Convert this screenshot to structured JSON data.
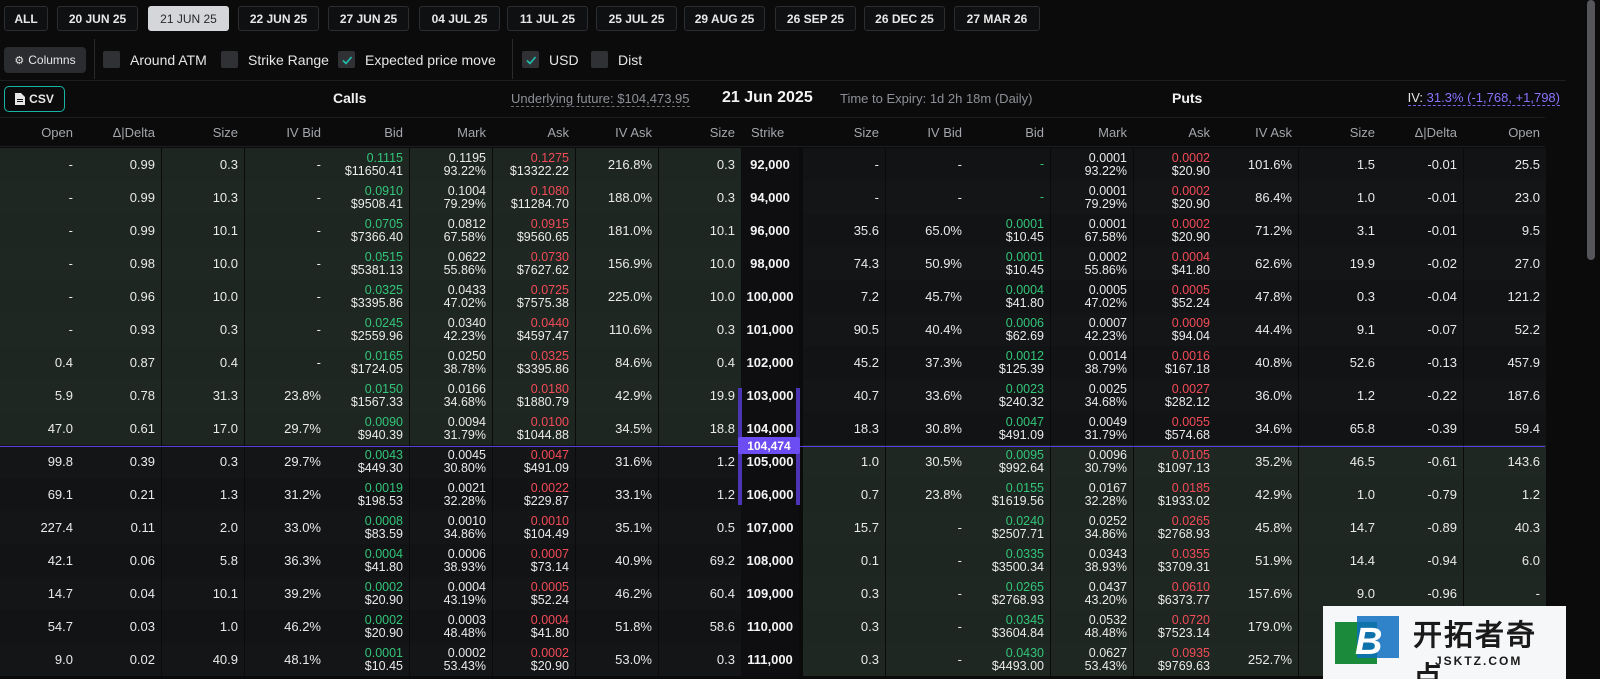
{
  "expiries": [
    "ALL",
    "20 JUN 25",
    "21 JUN 25",
    "22 JUN 25",
    "27 JUN 25",
    "04 JUL 25",
    "11 JUL 25",
    "25 JUL 25",
    "29 AUG 25",
    "26 SEP 25",
    "26 DEC 25",
    "27 MAR 26"
  ],
  "active_expiry": "21 JUN 25",
  "filters": {
    "columns_label": "Columns",
    "around_atm": {
      "label": "Around ATM",
      "checked": false
    },
    "strike_range": {
      "label": "Strike Range",
      "checked": false
    },
    "expected_move": {
      "label": "Expected price move",
      "checked": true
    },
    "usd": {
      "label": "USD",
      "checked": true
    },
    "dist": {
      "label": "Dist",
      "checked": false
    }
  },
  "header": {
    "csv_label": "CSV",
    "calls_label": "Calls",
    "puts_label": "Puts",
    "underlying": "Underlying future: $104,473.95",
    "date": "21 Jun 2025",
    "time_to_expiry": "Time to Expiry: 1d 2h 18m (Daily)",
    "iv_prefix": "IV: ",
    "iv_value": "31.3% (-1,768, +1,798)"
  },
  "columns": {
    "calls": [
      "Open",
      "Δ|Delta",
      "Size",
      "IV Bid",
      "Bid",
      "Mark",
      "Ask",
      "IV Ask",
      "Size"
    ],
    "strike": "Strike",
    "puts": [
      "Size",
      "IV Bid",
      "Bid",
      "Mark",
      "Ask",
      "IV Ask",
      "Size",
      "Δ|Delta",
      "Open"
    ]
  },
  "underlying_tag": "104,474",
  "colors": {
    "bid": "#33c57a",
    "ask": "#f34b58",
    "accent": "#6c4cf3",
    "csv_border": "#16b5a6"
  },
  "rows": [
    {
      "strike": "92,000",
      "c": [
        "-",
        "0.99",
        "0.3",
        "-",
        [
          "0.1115",
          "$11650.41"
        ],
        [
          "0.1195",
          "93.22%"
        ],
        [
          "0.1275",
          "$13322.22"
        ],
        "216.8%",
        "0.3"
      ],
      "p": [
        "-",
        "-",
        [
          "-",
          ""
        ],
        [
          "0.0001",
          "93.22%"
        ],
        [
          "0.0002",
          "$20.90"
        ],
        "101.6%",
        "1.5",
        "-0.01",
        "25.5"
      ],
      "itm": "call"
    },
    {
      "strike": "94,000",
      "c": [
        "-",
        "0.99",
        "10.3",
        "-",
        [
          "0.0910",
          "$9508.41"
        ],
        [
          "0.1004",
          "79.29%"
        ],
        [
          "0.1080",
          "$11284.70"
        ],
        "188.0%",
        "0.3"
      ],
      "p": [
        "-",
        "-",
        [
          "-",
          ""
        ],
        [
          "0.0001",
          "79.29%"
        ],
        [
          "0.0002",
          "$20.90"
        ],
        "86.4%",
        "1.0",
        "-0.01",
        "23.0"
      ],
      "itm": "call"
    },
    {
      "strike": "96,000",
      "c": [
        "-",
        "0.99",
        "10.1",
        "-",
        [
          "0.0705",
          "$7366.40"
        ],
        [
          "0.0812",
          "67.58%"
        ],
        [
          "0.0915",
          "$9560.65"
        ],
        "181.0%",
        "10.1"
      ],
      "p": [
        "35.6",
        "65.0%",
        [
          "0.0001",
          "$10.45"
        ],
        [
          "0.0001",
          "67.58%"
        ],
        [
          "0.0002",
          "$20.90"
        ],
        "71.2%",
        "3.1",
        "-0.01",
        "9.5"
      ],
      "itm": "call"
    },
    {
      "strike": "98,000",
      "c": [
        "-",
        "0.98",
        "10.0",
        "-",
        [
          "0.0515",
          "$5381.13"
        ],
        [
          "0.0622",
          "55.86%"
        ],
        [
          "0.0730",
          "$7627.62"
        ],
        "156.9%",
        "10.0"
      ],
      "p": [
        "74.3",
        "50.9%",
        [
          "0.0001",
          "$10.45"
        ],
        [
          "0.0002",
          "55.86%"
        ],
        [
          "0.0004",
          "$41.80"
        ],
        "62.6%",
        "19.9",
        "-0.02",
        "27.0"
      ],
      "itm": "call"
    },
    {
      "strike": "100,000",
      "c": [
        "-",
        "0.96",
        "10.0",
        "-",
        [
          "0.0325",
          "$3395.86"
        ],
        [
          "0.0433",
          "47.02%"
        ],
        [
          "0.0725",
          "$7575.38"
        ],
        "225.0%",
        "10.0"
      ],
      "p": [
        "7.2",
        "45.7%",
        [
          "0.0004",
          "$41.80"
        ],
        [
          "0.0005",
          "47.02%"
        ],
        [
          "0.0005",
          "$52.24"
        ],
        "47.8%",
        "0.3",
        "-0.04",
        "121.2"
      ],
      "itm": "call"
    },
    {
      "strike": "101,000",
      "c": [
        "-",
        "0.93",
        "0.3",
        "-",
        [
          "0.0245",
          "$2559.96"
        ],
        [
          "0.0340",
          "42.23%"
        ],
        [
          "0.0440",
          "$4597.47"
        ],
        "110.6%",
        "0.3"
      ],
      "p": [
        "90.5",
        "40.4%",
        [
          "0.0006",
          "$62.69"
        ],
        [
          "0.0007",
          "42.23%"
        ],
        [
          "0.0009",
          "$94.04"
        ],
        "44.4%",
        "9.1",
        "-0.07",
        "52.2"
      ],
      "itm": "call"
    },
    {
      "strike": "102,000",
      "c": [
        "0.4",
        "0.87",
        "0.4",
        "-",
        [
          "0.0165",
          "$1724.05"
        ],
        [
          "0.0250",
          "38.78%"
        ],
        [
          "0.0325",
          "$3395.86"
        ],
        "84.6%",
        "0.4"
      ],
      "p": [
        "45.2",
        "37.3%",
        [
          "0.0012",
          "$125.39"
        ],
        [
          "0.0014",
          "38.79%"
        ],
        [
          "0.0016",
          "$167.18"
        ],
        "40.8%",
        "52.6",
        "-0.13",
        "457.9"
      ],
      "itm": "call"
    },
    {
      "strike": "103,000",
      "c": [
        "5.9",
        "0.78",
        "31.3",
        "23.8%",
        [
          "0.0150",
          "$1567.33"
        ],
        [
          "0.0166",
          "34.68%"
        ],
        [
          "0.0180",
          "$1880.79"
        ],
        "42.9%",
        "19.9"
      ],
      "p": [
        "40.7",
        "33.6%",
        [
          "0.0023",
          "$240.32"
        ],
        [
          "0.0025",
          "34.68%"
        ],
        [
          "0.0027",
          "$282.12"
        ],
        "36.0%",
        "1.2",
        "-0.22",
        "187.6"
      ],
      "itm": "call"
    },
    {
      "strike": "104,000",
      "c": [
        "47.0",
        "0.61",
        "17.0",
        "29.7%",
        [
          "0.0090",
          "$940.39"
        ],
        [
          "0.0094",
          "31.79%"
        ],
        [
          "0.0100",
          "$1044.88"
        ],
        "34.5%",
        "18.8"
      ],
      "p": [
        "18.3",
        "30.8%",
        [
          "0.0047",
          "$491.09"
        ],
        [
          "0.0049",
          "31.79%"
        ],
        [
          "0.0055",
          "$574.68"
        ],
        "34.6%",
        "65.8",
        "-0.39",
        "59.4"
      ],
      "itm": "call"
    },
    {
      "strike": "105,000",
      "c": [
        "99.8",
        "0.39",
        "0.3",
        "29.7%",
        [
          "0.0043",
          "$449.30"
        ],
        [
          "0.0045",
          "30.80%"
        ],
        [
          "0.0047",
          "$491.09"
        ],
        "31.6%",
        "1.2"
      ],
      "p": [
        "1.0",
        "30.5%",
        [
          "0.0095",
          "$992.64"
        ],
        [
          "0.0096",
          "30.79%"
        ],
        [
          "0.0105",
          "$1097.13"
        ],
        "35.2%",
        "46.5",
        "-0.61",
        "143.6"
      ],
      "itm": "put"
    },
    {
      "strike": "106,000",
      "c": [
        "69.1",
        "0.21",
        "1.3",
        "31.2%",
        [
          "0.0019",
          "$198.53"
        ],
        [
          "0.0021",
          "32.28%"
        ],
        [
          "0.0022",
          "$229.87"
        ],
        "33.1%",
        "1.2"
      ],
      "p": [
        "0.7",
        "23.8%",
        [
          "0.0155",
          "$1619.56"
        ],
        [
          "0.0167",
          "32.28%"
        ],
        [
          "0.0185",
          "$1933.02"
        ],
        "42.9%",
        "1.0",
        "-0.79",
        "1.2"
      ],
      "itm": "put"
    },
    {
      "strike": "107,000",
      "c": [
        "227.4",
        "0.11",
        "2.0",
        "33.0%",
        [
          "0.0008",
          "$83.59"
        ],
        [
          "0.0010",
          "34.86%"
        ],
        [
          "0.0010",
          "$104.49"
        ],
        "35.1%",
        "0.5"
      ],
      "p": [
        "15.7",
        "-",
        [
          "0.0240",
          "$2507.71"
        ],
        [
          "0.0252",
          "34.86%"
        ],
        [
          "0.0265",
          "$2768.93"
        ],
        "45.8%",
        "14.7",
        "-0.89",
        "40.3"
      ],
      "itm": "put"
    },
    {
      "strike": "108,000",
      "c": [
        "42.1",
        "0.06",
        "5.8",
        "36.3%",
        [
          "0.0004",
          "$41.80"
        ],
        [
          "0.0006",
          "38.93%"
        ],
        [
          "0.0007",
          "$73.14"
        ],
        "40.9%",
        "69.2"
      ],
      "p": [
        "0.1",
        "-",
        [
          "0.0335",
          "$3500.34"
        ],
        [
          "0.0343",
          "38.93%"
        ],
        [
          "0.0355",
          "$3709.31"
        ],
        "51.9%",
        "14.4",
        "-0.94",
        "6.0"
      ],
      "itm": "put"
    },
    {
      "strike": "109,000",
      "c": [
        "14.7",
        "0.04",
        "10.1",
        "39.2%",
        [
          "0.0002",
          "$20.90"
        ],
        [
          "0.0004",
          "43.19%"
        ],
        [
          "0.0005",
          "$52.24"
        ],
        "46.2%",
        "60.4"
      ],
      "p": [
        "0.3",
        "-",
        [
          "0.0265",
          "$2768.93"
        ],
        [
          "0.0437",
          "43.20%"
        ],
        [
          "0.0610",
          "$6373.77"
        ],
        "157.6%",
        "9.0",
        "-0.96",
        "-"
      ],
      "itm": "put"
    },
    {
      "strike": "110,000",
      "c": [
        "54.7",
        "0.03",
        "1.0",
        "46.2%",
        [
          "0.0002",
          "$20.90"
        ],
        [
          "0.0003",
          "48.48%"
        ],
        [
          "0.0004",
          "$41.80"
        ],
        "51.8%",
        "58.6"
      ],
      "p": [
        "0.3",
        "-",
        [
          "0.0345",
          "$3604.84"
        ],
        [
          "0.0532",
          "48.48%"
        ],
        [
          "0.0720",
          "$7523.14"
        ],
        "179.0%",
        "",
        "",
        " "
      ],
      "itm": "put"
    },
    {
      "strike": "111,000",
      "c": [
        "9.0",
        "0.02",
        "40.9",
        "48.1%",
        [
          "0.0001",
          "$10.45"
        ],
        [
          "0.0002",
          "53.43%"
        ],
        [
          "0.0002",
          "$20.90"
        ],
        "53.0%",
        "0.3"
      ],
      "p": [
        "0.3",
        "-",
        [
          "0.0430",
          "$4493.00"
        ],
        [
          "0.0627",
          "53.43%"
        ],
        [
          "0.0935",
          "$9769.63"
        ],
        "252.7%",
        "",
        "",
        ""
      ],
      "itm": "put"
    }
  ],
  "watermark": {
    "cn": "开拓者奇点",
    "url": "JSKTZ.COM"
  }
}
